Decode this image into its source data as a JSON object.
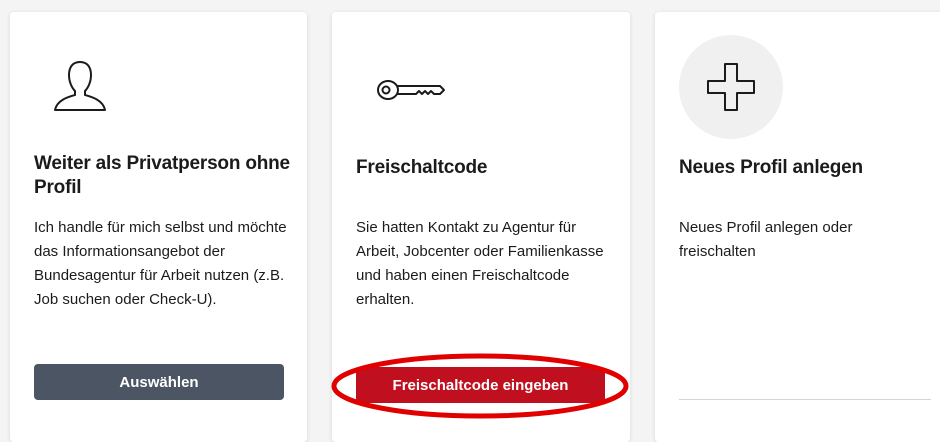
{
  "cards": [
    {
      "title": "Weiter als Privatperson ohne Profil",
      "text": "Ich handle für mich selbst und möchte das Informationsangebot der Bundesagentur für Arbeit nutzen (z.B. Job suchen oder Check-U).",
      "button_label": "Auswählen",
      "icon": "person-icon"
    },
    {
      "title": "Freischaltcode",
      "text": "Sie hatten Kontakt zu Agentur für Arbeit, Jobcenter oder Familienkasse und haben einen Freischaltcode erhalten.",
      "button_label": "Freischaltcode eingeben",
      "icon": "key-icon"
    },
    {
      "title": "Neues Profil anlegen",
      "text": "Neues Profil anlegen oder freischalten",
      "icon": "plus-icon"
    }
  ],
  "colors": {
    "primary_red": "#c0101f",
    "button_grey": "#4b5563",
    "highlight": "#e00000",
    "background": "#f4f4f4"
  }
}
